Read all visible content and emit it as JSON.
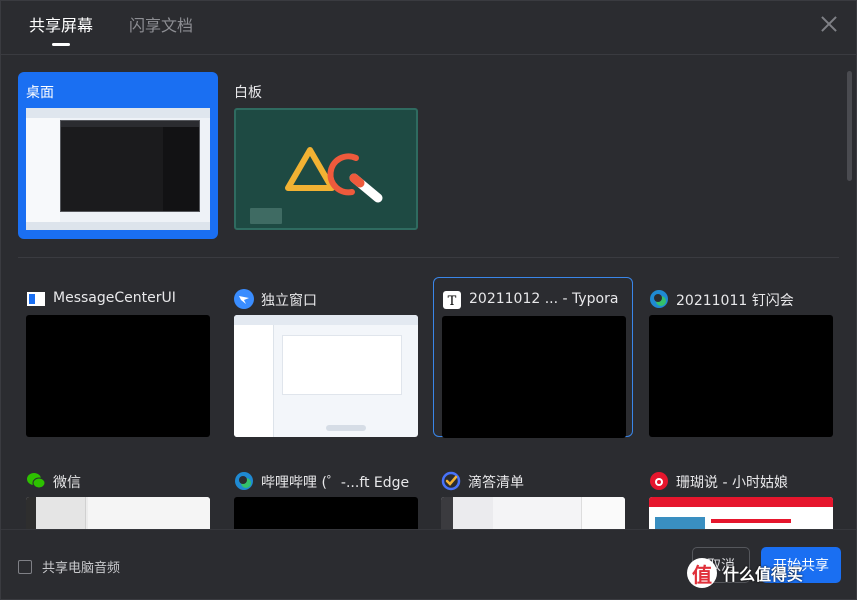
{
  "tabs": [
    {
      "label": "共享屏幕",
      "active": true
    },
    {
      "label": "闪享文档",
      "active": false
    }
  ],
  "top_sources": [
    {
      "label": "桌面",
      "selected": true
    },
    {
      "label": "白板",
      "selected": false
    }
  ],
  "windows": [
    {
      "label": "MessageCenterUI",
      "icon": "message-center-icon"
    },
    {
      "label": "独立窗口",
      "icon": "dingtalk-icon"
    },
    {
      "label": "20211012 ... - Typora",
      "icon": "typora-icon",
      "selected": true
    },
    {
      "label": "20211011 钉闪会",
      "icon": "edge-icon"
    },
    {
      "label": "微信",
      "icon": "wechat-icon"
    },
    {
      "label": "哔哩哔哩 (゜-...ft Edge",
      "icon": "edge-icon"
    },
    {
      "label": "滴答清单",
      "icon": "ticktick-icon"
    },
    {
      "label": "珊瑚说 - 小时姑娘",
      "icon": "weibo-icon"
    }
  ],
  "footer": {
    "audio_label": "共享电脑音频",
    "audio_checked": false,
    "cancel_label": "取消",
    "share_label": "开始共享"
  },
  "watermark": {
    "logo_text": "值",
    "text": "什么值得买"
  },
  "colors": {
    "accent": "#1a6ff2",
    "background": "#2b2c30",
    "whiteboard": "#1e4a43"
  }
}
